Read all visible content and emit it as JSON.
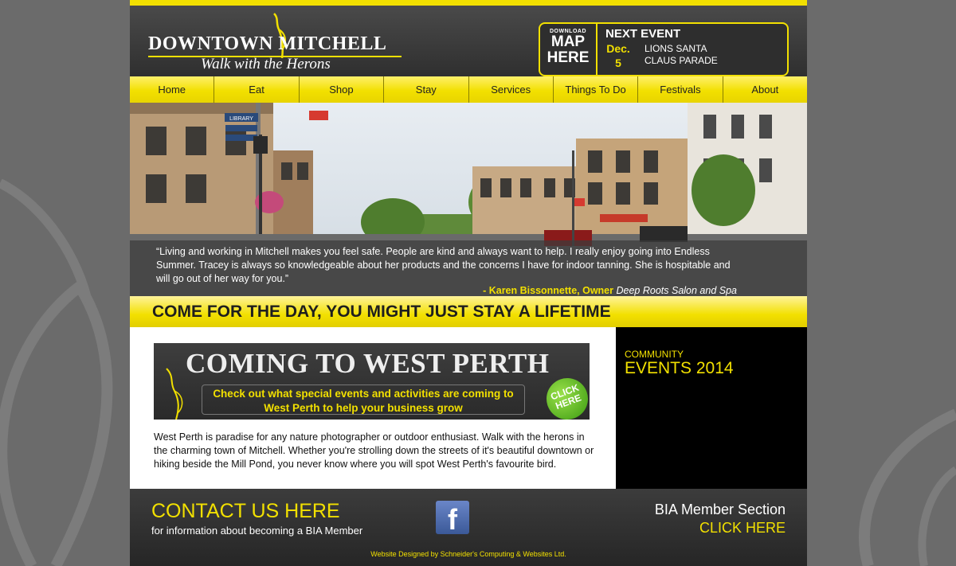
{
  "header": {
    "logo_title": "DOWNTOWN MITCHELL",
    "logo_tagline": "Walk with the Herons",
    "map_download": "DOWNLOAD",
    "map_line1": "MAP",
    "map_line2": "HERE",
    "next_event_title": "NEXT EVENT",
    "next_event_month": "Dec.",
    "next_event_day": "5",
    "next_event_name": "LIONS SANTA CLAUS PARADE"
  },
  "nav": [
    "Home",
    "Eat",
    "Shop",
    "Stay",
    "Services",
    "Things To Do",
    "Festivals",
    "About"
  ],
  "hero": {
    "quote": "“Living and working in Mitchell makes you feel safe. People are kind and always want to help. I really enjoy going into Endless Summer. Tracey is always so knowledgeable about her products and the concerns I have for indoor tanning. She is hospitable and will go out of her way for you.”",
    "author": "- Karen Bissonnette, Owner",
    "business": "Deep Roots Salon and Spa",
    "sign_library": "LIBRARY"
  },
  "slogan": "COME FOR THE DAY, YOU MIGHT JUST STAY A LIFETIME",
  "banner": {
    "title": "COMING TO WEST PERTH",
    "subtitle": "Check out what special events and activities are coming to West Perth to help your business grow",
    "click_here": "CLICK HERE"
  },
  "body_text": "West Perth is paradise for any nature photographer or outdoor enthusiast. Walk with the herons in the charming town of Mitchell. Whether you're strolling down the streets of it's beautiful downtown or hiking beside the Mill Pond, you never know where you will spot West Perth's favourite bird.",
  "sidebar": {
    "small": "COMMUNITY",
    "big": "EVENTS 2014"
  },
  "footer": {
    "contact_title": "CONTACT US HERE",
    "contact_sub": "for information about becoming a BIA Member",
    "facebook": "f",
    "bia_title": "BIA Member Section",
    "bia_click": "CLICK HERE",
    "credit": "Website Designed by Schneider's Computing & Websites Ltd."
  },
  "colors": {
    "accent_yellow": "#f2e000",
    "page_bg": "#6b6b6b",
    "dark_panel": "#3a3a3a"
  }
}
